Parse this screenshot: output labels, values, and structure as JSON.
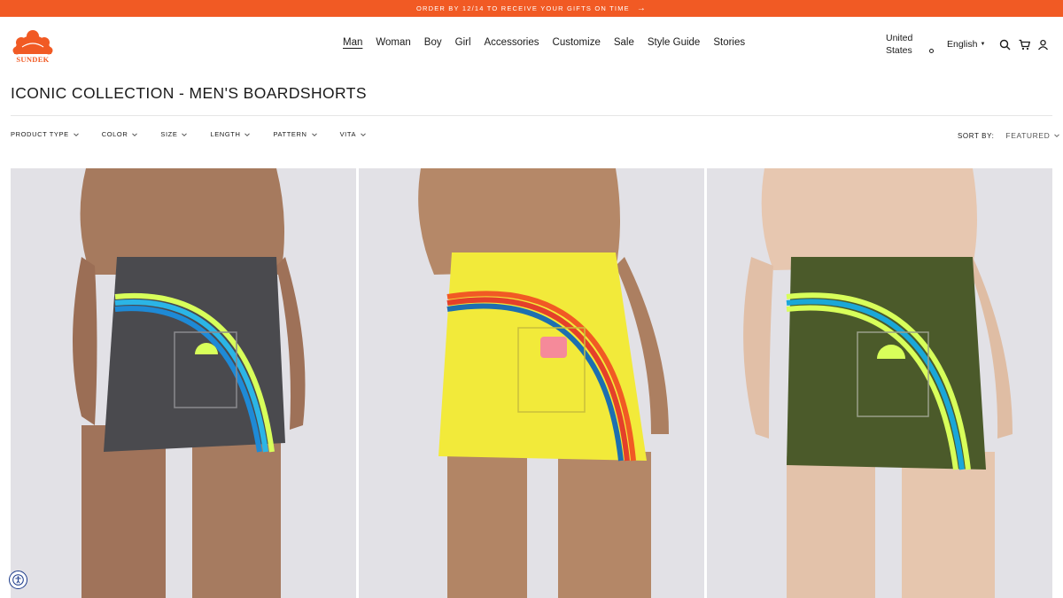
{
  "promo": {
    "text": "ORDER BY 12/14 TO RECEIVE YOUR GIFTS ON TIME",
    "arrow": "→",
    "color": "#f15a24"
  },
  "brand": {
    "name": "SUNDEK",
    "color": "#f15a24"
  },
  "nav": {
    "items": [
      {
        "label": "Man",
        "active": true
      },
      {
        "label": "Woman"
      },
      {
        "label": "Boy"
      },
      {
        "label": "Girl"
      },
      {
        "label": "Accessories"
      },
      {
        "label": "Customize"
      },
      {
        "label": "Sale"
      },
      {
        "label": "Style Guide"
      },
      {
        "label": "Stories"
      }
    ]
  },
  "header": {
    "country_line1": "United",
    "country_line2": "States",
    "language": "English",
    "icons": [
      "search-icon",
      "cart-icon",
      "account-icon"
    ]
  },
  "page": {
    "title": "ICONIC COLLECTION - MEN'S BOARDSHORTS"
  },
  "filters": [
    {
      "label": "PRODUCT TYPE"
    },
    {
      "label": "COLOR"
    },
    {
      "label": "SIZE"
    },
    {
      "label": "LENGTH"
    },
    {
      "label": "PATTERN"
    },
    {
      "label": "VITA"
    }
  ],
  "sort": {
    "label": "SORT BY:",
    "value": "FEATURED"
  },
  "products": [
    {
      "color_name": "charcoal",
      "shorts_color": "#4a4a4e",
      "stripes": [
        "#d8ff5a",
        "#2bb5e6",
        "#1e8ad6"
      ]
    },
    {
      "color_name": "yellow",
      "shorts_color": "#f2ea3a",
      "stripes": [
        "#f15a24",
        "#e4402a",
        "#1d6fb0"
      ]
    },
    {
      "color_name": "olive",
      "shorts_color": "#4b5a2a",
      "stripes": [
        "#d8ff5a",
        "#1aa7d8",
        "#d8ff5a"
      ]
    }
  ],
  "accessibility": {
    "icon": "accessibility-icon",
    "color": "#1b3a8a"
  }
}
